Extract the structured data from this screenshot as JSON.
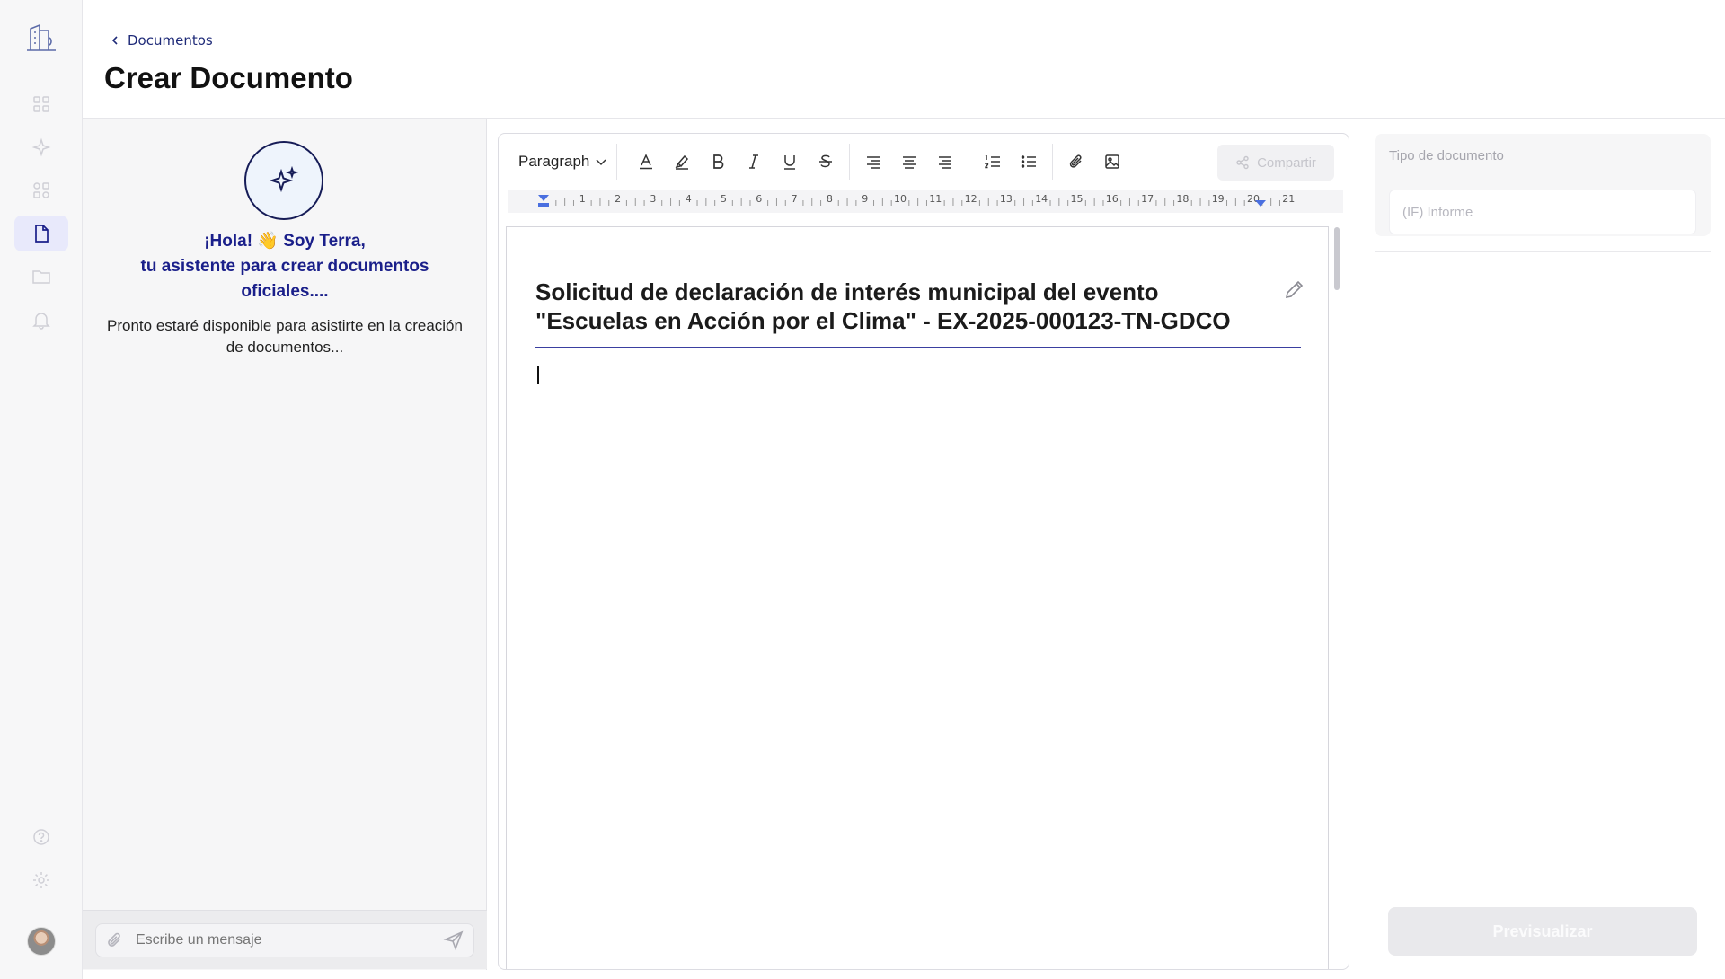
{
  "sidebar": {
    "logo": "building-logo",
    "items": [
      {
        "name": "dashboard",
        "icon": "grid-icon"
      },
      {
        "name": "assistant",
        "icon": "sparkle-icon"
      },
      {
        "name": "apps",
        "icon": "apps-grid-icon"
      },
      {
        "name": "documents",
        "icon": "document-icon",
        "active": true
      },
      {
        "name": "folders",
        "icon": "folder-icon"
      },
      {
        "name": "notifications",
        "icon": "bell-icon"
      }
    ],
    "bottom": [
      {
        "name": "help",
        "icon": "help-icon"
      },
      {
        "name": "settings",
        "icon": "gear-icon"
      }
    ]
  },
  "header": {
    "breadcrumb": "Documentos",
    "title": "Crear Documento"
  },
  "assistant": {
    "greeting_line1": "¡Hola! 👋 Soy Terra,",
    "greeting_line2": "tu asistente para crear documentos oficiales....",
    "message": "Pronto estaré disponible para asistirte en la creación de documentos...",
    "input_placeholder": "Escribe un mensaje"
  },
  "editor": {
    "block_type": "Paragraph",
    "toolbar": {
      "format": [
        "text-color",
        "highlight",
        "bold",
        "italic",
        "underline",
        "strikethrough"
      ],
      "align": [
        "align-left",
        "align-center",
        "align-right"
      ],
      "lists": [
        "ordered-list",
        "bullet-list"
      ],
      "insert": [
        "attachment",
        "image"
      ]
    },
    "share_label": "Compartir",
    "ruler_numbers": [
      "1",
      "2",
      "3",
      "4",
      "5",
      "6",
      "7",
      "8",
      "9",
      "10",
      "11",
      "12",
      "13",
      "14",
      "15",
      "16",
      "17",
      "18",
      "19",
      "20",
      "21"
    ],
    "document_title": "Solicitud de declaración de interés municipal del evento \"Escuelas en Acción por el Clima\" - EX-2025-000123-TN-GDCO"
  },
  "rightpanel": {
    "doc_type_label": "Tipo de documento",
    "doc_type_value": "(IF) Informe",
    "preview_label": "Previsualizar"
  },
  "colors": {
    "accent": "#1a1f8a",
    "sidebar_active_bg": "#e8e9fb",
    "ruler_marker": "#4a6fe0"
  }
}
